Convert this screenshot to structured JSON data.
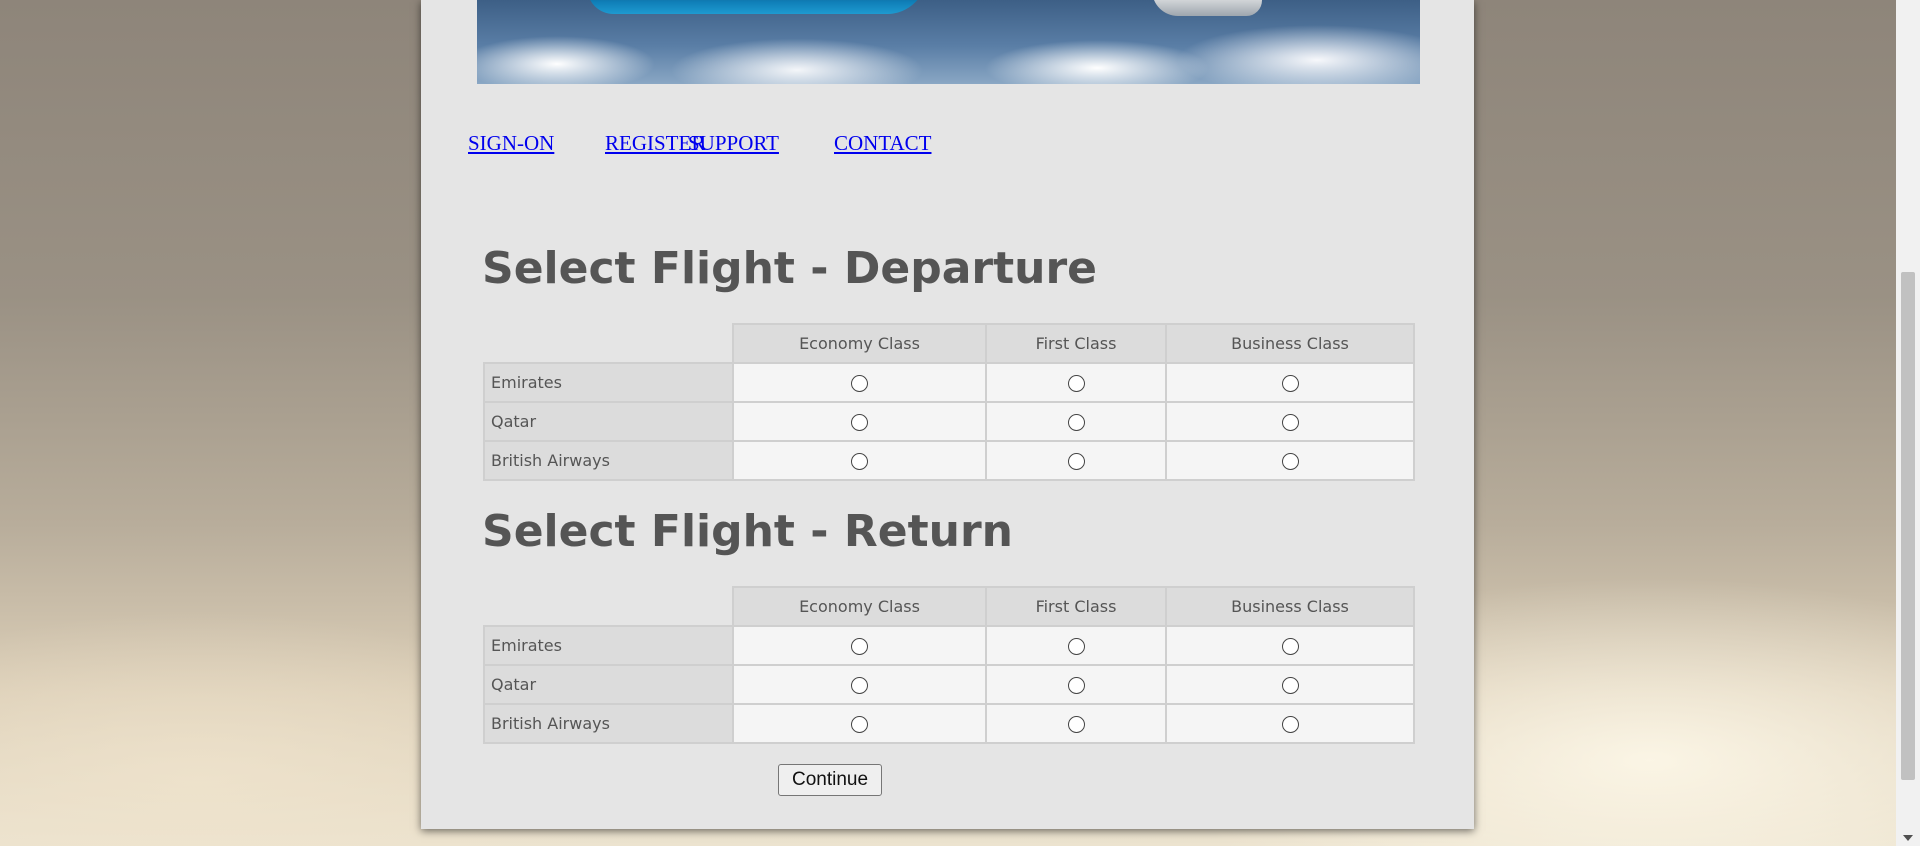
{
  "nav": {
    "items": [
      "SIGN-ON",
      "REGISTER",
      "SUPPORT",
      "CONTACT"
    ]
  },
  "departure": {
    "title": "Select Flight - Departure",
    "columns": [
      "Economy Class",
      "First Class",
      "Business Class"
    ],
    "rows": [
      "Emirates",
      "Qatar",
      "British Airways"
    ]
  },
  "return": {
    "title": "Select Flight - Return",
    "columns": [
      "Economy Class",
      "First Class",
      "Business Class"
    ],
    "rows": [
      "Emirates",
      "Qatar",
      "British Airways"
    ]
  },
  "continue_label": "Continue",
  "icons": {
    "radio": "radio-button-unchecked-icon",
    "scroll_down": "chevron-down-icon"
  }
}
